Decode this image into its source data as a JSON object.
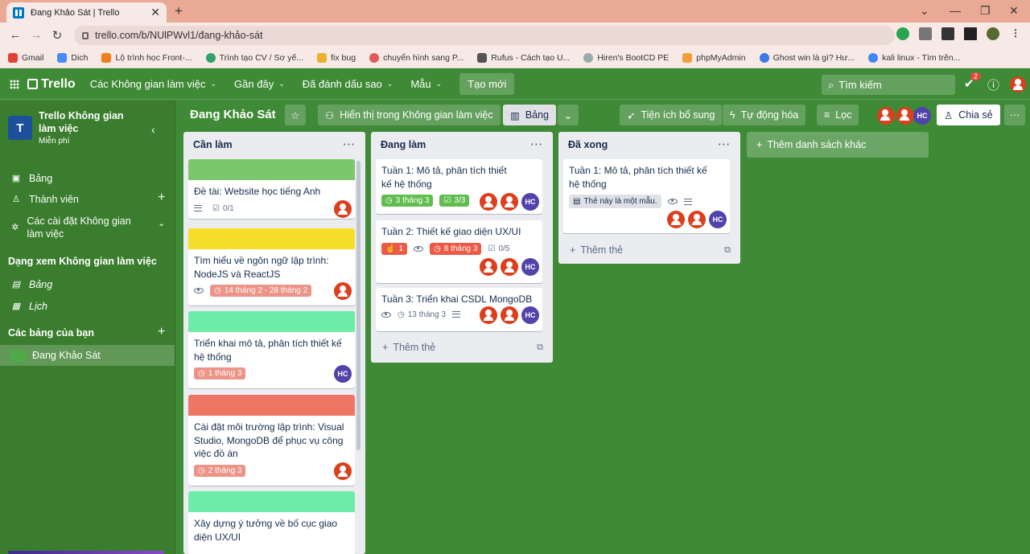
{
  "browser": {
    "tab_title": "Đang Khảo Sát | Trello",
    "url": "trello.com/b/NUlPWvl1/đang-khảo-sát",
    "bookmarks": [
      "Gmail",
      "Dich",
      "Lộ trình học Front-...",
      "Trình tạo CV / Sơ yế...",
      "fix bug",
      "chuyển hình sang P...",
      "Rufus - Cách tạo U...",
      "Hiren's BootCD PE",
      "phpMyAdmin",
      "Ghost win là gì? Hư...",
      "kali linux - Tìm trên..."
    ]
  },
  "topbar": {
    "logo": "Trello",
    "menus": [
      "Các Không gian làm việc",
      "Gần đây",
      "Đã đánh dấu sao",
      "Mẫu"
    ],
    "create": "Tạo mới",
    "search_placeholder": "Tìm kiếm",
    "notification_count": "2"
  },
  "sidebar": {
    "workspace_initial": "T",
    "workspace_name": "Trello Không gian làm việc",
    "workspace_plan": "Miễn phí",
    "items": [
      "Bảng",
      "Thành viên",
      "Các cài đặt Không gian làm việc"
    ],
    "views_heading": "Dạng xem Không gian làm việc",
    "views": [
      "Bảng",
      "Lịch"
    ],
    "boards_heading": "Các bảng của bạn",
    "boards": [
      "Đang Khảo Sát"
    ]
  },
  "board": {
    "title": "Đang Khảo Sát",
    "visibility": "Hiển thị trong Không gian làm việc",
    "view": "Bảng",
    "powerups": "Tiện ích bổ sung",
    "automation": "Tự động hóa",
    "filter": "Lọc",
    "member_initials": "HC",
    "share": "Chia sẻ",
    "add_list": "Thêm danh sách khác",
    "add_card": "Thêm thẻ"
  },
  "lists": [
    {
      "title": "Cần làm",
      "cards": [
        {
          "cover": "#7bc86c",
          "text": "Đề tài: Website học tiếng Anh",
          "checklist": "0/1"
        },
        {
          "cover": "#f5dd29",
          "text": "Tìm hiểu về ngôn ngữ lập trình: NodeJS và ReactJS",
          "date": "14 tháng 2 - 28 tháng 2"
        },
        {
          "cover": "#6deca9",
          "text": "Triển khai mô tả, phân tích thiết kế hệ thống",
          "date": "1 tháng 3"
        },
        {
          "cover": "#ef7564",
          "text": "Cài đặt môi trường lập trình: Visual Studio, MongoDB để phục vụ công việc đồ án",
          "date": "2 tháng 3"
        },
        {
          "cover": "#6deca9",
          "text": "Xây dựng ý tưởng về bố cục giao diện UX/UI"
        }
      ]
    },
    {
      "title": "Đang làm",
      "cards": [
        {
          "text": "Tuần 1: Mô tả, phân tích thiết kế hệ thống",
          "date": "3 tháng 3",
          "checklist": "3/3"
        },
        {
          "text": "Tuần 2: Thiết kế giao diện UX/UI",
          "votes": "1",
          "date": "8 tháng 3",
          "checklist": "0/5"
        },
        {
          "text": "Tuần 3: Triển khai CSDL MongoDB",
          "date": "13 tháng 3"
        }
      ]
    },
    {
      "title": "Đã xong",
      "cards": [
        {
          "text": "Tuần 1: Mô tả, phân tích thiết kế hệ thống",
          "template": "Thẻ này là một mẫu."
        }
      ]
    }
  ]
}
